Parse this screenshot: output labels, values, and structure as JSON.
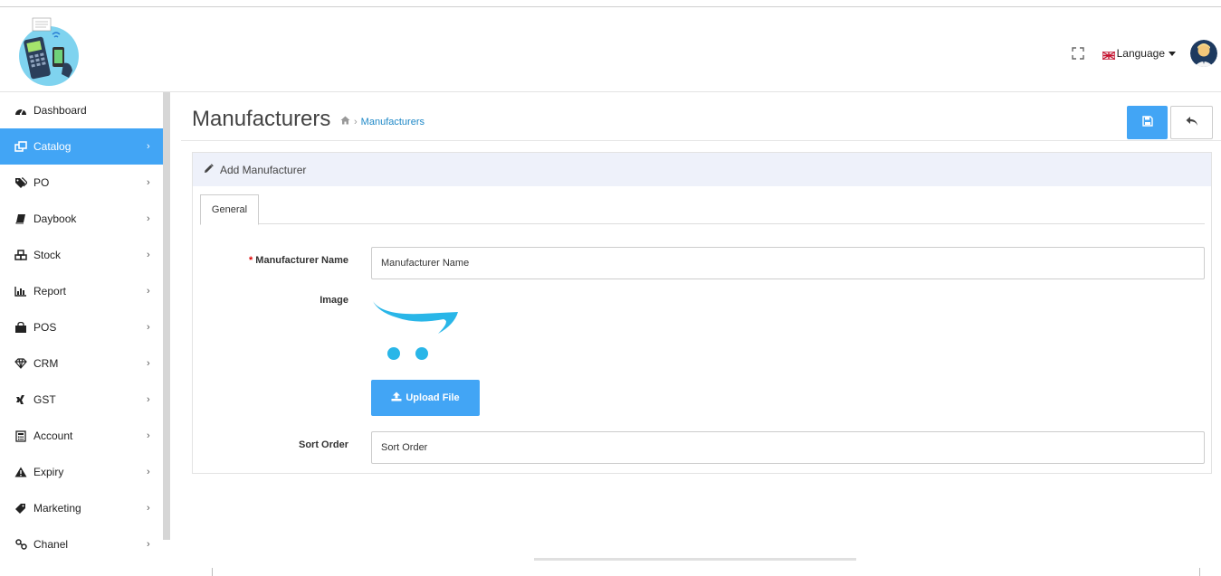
{
  "header": {
    "language_label": "Language",
    "icons": {
      "fullscreen": "fullscreen-icon",
      "flag": "uk-flag-icon",
      "avatar": "user-avatar"
    }
  },
  "sidebar": {
    "items": [
      {
        "label": "Dashboard",
        "icon": "dashboard-icon",
        "active": false,
        "has_children": false
      },
      {
        "label": "Catalog",
        "icon": "catalog-icon",
        "active": true,
        "has_children": true
      },
      {
        "label": "PO",
        "icon": "tags-icon",
        "active": false,
        "has_children": true
      },
      {
        "label": "Daybook",
        "icon": "book-icon",
        "active": false,
        "has_children": true
      },
      {
        "label": "Stock",
        "icon": "cubes-icon",
        "active": false,
        "has_children": true
      },
      {
        "label": "Report",
        "icon": "bar-chart-icon",
        "active": false,
        "has_children": true
      },
      {
        "label": "POS",
        "icon": "shopping-bag-icon",
        "active": false,
        "has_children": true
      },
      {
        "label": "CRM",
        "icon": "diamond-icon",
        "active": false,
        "has_children": true
      },
      {
        "label": "GST",
        "icon": "xing-icon",
        "active": false,
        "has_children": true
      },
      {
        "label": "Account",
        "icon": "calculator-icon",
        "active": false,
        "has_children": true
      },
      {
        "label": "Expiry",
        "icon": "warning-icon",
        "active": false,
        "has_children": true
      },
      {
        "label": "Marketing",
        "icon": "tag-icon",
        "active": false,
        "has_children": true
      },
      {
        "label": "Chanel",
        "icon": "link-icon",
        "active": false,
        "has_children": true
      }
    ]
  },
  "page": {
    "title": "Manufacturers",
    "breadcrumb": {
      "home_icon": "home-icon",
      "current": "Manufacturers"
    },
    "buttons": {
      "save_icon": "save-icon",
      "back_icon": "reply-icon"
    }
  },
  "panel": {
    "heading": "Add Manufacturer",
    "tabs": [
      {
        "label": "General",
        "active": true
      }
    ],
    "form": {
      "name_label": "Manufacturer Name",
      "name_placeholder": "Manufacturer Name",
      "image_label": "Image",
      "upload_label": "Upload File",
      "sort_label": "Sort Order",
      "sort_placeholder": "Sort Order"
    }
  },
  "colors": {
    "accent": "#42a5f5",
    "panel_head_bg": "#eef1fa",
    "breadcrumb_link": "#1e88c7",
    "required": "#dd0000"
  }
}
